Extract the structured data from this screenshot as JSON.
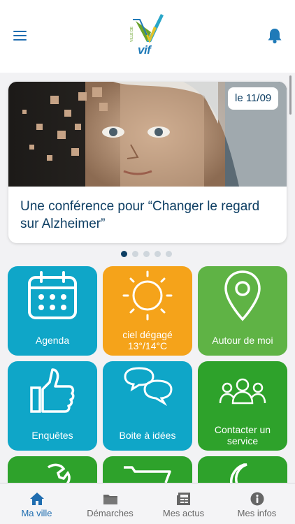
{
  "header": {
    "menu_icon": "hamburger-menu-icon",
    "notifications_icon": "bell-icon",
    "logo_caption": "VILLE DE",
    "logo_text": "vif",
    "colors": {
      "primary": "#1f6db0",
      "bell": "#1f7ab8"
    }
  },
  "featured": {
    "date": "le 11/09",
    "title": "Une conférence pour “Changer le regard sur Alzheimer”",
    "dots_total": 5,
    "active_dot": 1
  },
  "tiles": [
    {
      "label": "Agenda",
      "icon": "calendar-icon",
      "color": "#0fa6c8"
    },
    {
      "label": "ciel dégagé 13°/14°C",
      "icon": "sun-icon",
      "color": "#f5a31a"
    },
    {
      "label": "Autour de moi",
      "icon": "map-pin-icon",
      "color": "#5fb345"
    },
    {
      "label": "Enquêtes",
      "icon": "thumbs-up-icon",
      "color": "#0fa6c8"
    },
    {
      "label": "Boite à idées",
      "icon": "chat-bubbles-icon",
      "color": "#0fa6c8"
    },
    {
      "label": "Contacter un service",
      "icon": "people-group-icon",
      "color": "#2ea22b"
    },
    {
      "label": "",
      "icon": "wrench-icon",
      "color": "#2ea22b"
    },
    {
      "label": "",
      "icon": "shopping-cart-icon",
      "color": "#2ea22b"
    },
    {
      "label": "",
      "icon": "moon-icon",
      "color": "#2ea22b"
    }
  ],
  "tabbar": {
    "tabs": [
      {
        "label": "Ma ville",
        "icon": "home-icon",
        "active": true
      },
      {
        "label": "Démarches",
        "icon": "folder-icon",
        "active": false
      },
      {
        "label": "Mes actus",
        "icon": "newspaper-icon",
        "active": false
      },
      {
        "label": "Mes infos",
        "icon": "info-icon",
        "active": false
      }
    ]
  }
}
